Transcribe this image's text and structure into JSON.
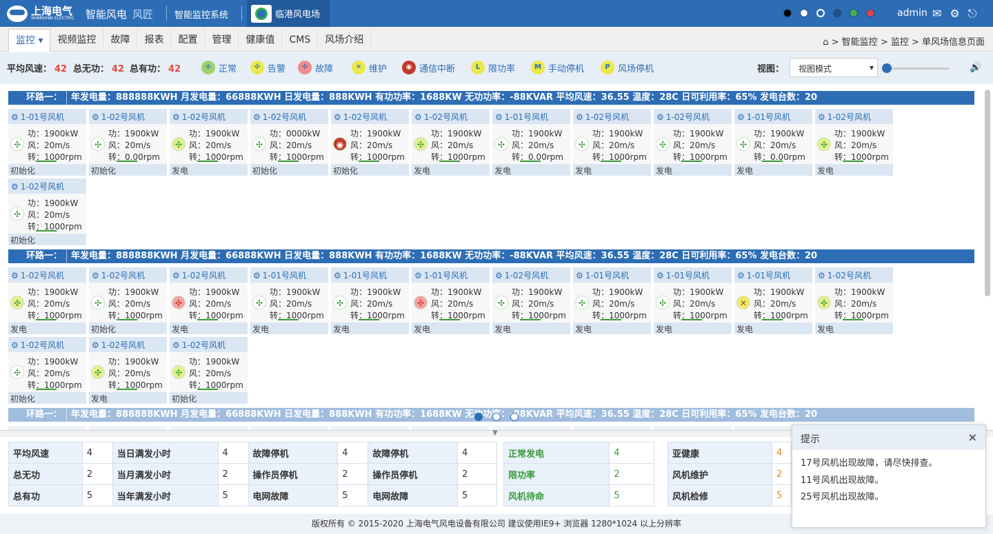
{
  "header": {
    "company": "上海电气",
    "company_en": "SHANGHAI ELECTRIC",
    "brand": "智能风电",
    "brand_sub": "风匠",
    "system": "智能监控系统",
    "farm": "临港风电场",
    "theme_colors": [
      "#000000",
      "#ffffff",
      "#2d6db5",
      "#1e4f86",
      "#4cb050",
      "#e0474c"
    ],
    "user": "admin"
  },
  "nav": {
    "items": [
      "监控",
      "视频监控",
      "故障",
      "报表",
      "配置",
      "管理",
      "健康值",
      "CMS",
      "风场介绍"
    ],
    "breadcrumb": "> 智能监控 > 监控 > 单风场信息页面"
  },
  "legend": {
    "stats": [
      {
        "label": "平均风速：",
        "value": "42"
      },
      {
        "label": "总无功：",
        "value": "42"
      },
      {
        "label": "总有功：",
        "value": "42"
      }
    ],
    "states": [
      {
        "label": "正常",
        "icon": "turbine-normal-icon",
        "color": "#9ed36a"
      },
      {
        "label": "告警",
        "icon": "turbine-alarm-icon",
        "color": "#e9e94a"
      },
      {
        "label": "故障",
        "icon": "turbine-fault-icon",
        "color": "#f28c8c"
      },
      {
        "label": "维护",
        "icon": "wrench-icon",
        "color": "#e9e94a"
      },
      {
        "label": "通信中断",
        "icon": "comm-lost-icon",
        "color": "#c0392b"
      },
      {
        "label": "限功率",
        "letter": "L",
        "color": "#e9e94a"
      },
      {
        "label": "手动停机",
        "letter": "M",
        "color": "#e9e94a"
      },
      {
        "label": "风场停机",
        "letter": "P",
        "color": "#e9e94a"
      }
    ],
    "view_label": "视图：",
    "view_value": "视图模式"
  },
  "loop_bar": {
    "label": "环路一：",
    "values": "年发电量：888888KWH 月发电量：66888KWH 日发电量：888KWH 有功功率：1688KW 无功功率：-88KVAR 平均风速：36.55 温度：28C 日可利用率：65% 发电台数：20"
  },
  "loops": [
    {
      "turbines": [
        {
          "name": "1-01号风机",
          "power": "功：1900kW",
          "wind": "风：20m/s",
          "speed": "转：1000rpm",
          "status": "初始化",
          "state": "normal"
        },
        {
          "name": "1-02号风机",
          "power": "功：1900kW",
          "wind": "风：20m/s",
          "speed": "转：0.00rpm",
          "status": "初始化",
          "state": "normal"
        },
        {
          "name": "1-02号风机",
          "power": "功：1900kW",
          "wind": "风：20m/s",
          "speed": "转：1000rpm",
          "status": "发电",
          "state": "active"
        },
        {
          "name": "1-02号风机",
          "power": "功：0000kW",
          "wind": "风：20m/s",
          "speed": "转：1000rpm",
          "status": "初始化",
          "state": "normal"
        },
        {
          "name": "1-02号风机",
          "power": "功：1900kW",
          "wind": "风：20m/s",
          "speed": "转：1000rpm",
          "status": "初始化",
          "state": "comm"
        },
        {
          "name": "1-02号风机",
          "power": "功：1900kW",
          "wind": "风：20m/s",
          "speed": "转：1000rpm",
          "status": "发电",
          "state": "active"
        },
        {
          "name": "1-01号风机",
          "power": "功：1900kW",
          "wind": "风：20m/s",
          "speed": "转：0.00rpm",
          "status": "发电",
          "state": "normal"
        },
        {
          "name": "1-02号风机",
          "power": "功：1900kW",
          "wind": "风：20m/s",
          "speed": "转：1000rpm",
          "status": "发电",
          "state": "normal"
        },
        {
          "name": "1-02号风机",
          "power": "功：1900kW",
          "wind": "风：20m/s",
          "speed": "转：1000rpm",
          "status": "发电",
          "state": "normal"
        },
        {
          "name": "1-01号风机",
          "power": "功：1900kW",
          "wind": "风：20m/s",
          "speed": "转：0.00rpm",
          "status": "发电",
          "state": "normal"
        },
        {
          "name": "1-02号风机",
          "power": "功：1900kW",
          "wind": "风：20m/s",
          "speed": "转：1000rpm",
          "status": "发电",
          "state": "active"
        },
        {
          "name": "1-02号风机",
          "power": "功：1900kW",
          "wind": "风：20m/s",
          "speed": "转：1000rpm",
          "status": "初始化",
          "state": "normal"
        }
      ]
    },
    {
      "turbines": [
        {
          "name": "1-02号风机",
          "power": "功：1900kW",
          "wind": "风：20m/s",
          "speed": "转：1000rpm",
          "status": "发电",
          "state": "active"
        },
        {
          "name": "1-02号风机",
          "power": "功：1900kW",
          "wind": "风：20m/s",
          "speed": "转：1000rpm",
          "status": "初始化",
          "state": "normal"
        },
        {
          "name": "1-02号风机",
          "power": "功：1900kW",
          "wind": "风：20m/s",
          "speed": "转：1000rpm",
          "status": "发电",
          "state": "fault"
        },
        {
          "name": "1-01号风机",
          "power": "功：1900kW",
          "wind": "风：20m/s",
          "speed": "转：1000rpm",
          "status": "发电",
          "state": "normal"
        },
        {
          "name": "1-01号风机",
          "power": "功：1900kW",
          "wind": "风：20m/s",
          "speed": "转：1000rpm",
          "status": "发电",
          "state": "normal"
        },
        {
          "name": "1-01号风机",
          "power": "功：1900kW",
          "wind": "风：20m/s",
          "speed": "转：1000rpm",
          "status": "发电",
          "state": "fault"
        },
        {
          "name": "1-02号风机",
          "power": "功：1900kW",
          "wind": "风：20m/s",
          "speed": "转：1000rpm",
          "status": "发电",
          "state": "normal"
        },
        {
          "name": "1-01号风机",
          "power": "功：1900kW",
          "wind": "风：20m/s",
          "speed": "转：1000rpm",
          "status": "发电",
          "state": "normal"
        },
        {
          "name": "1-01号风机",
          "power": "功：1900kW",
          "wind": "风：20m/s",
          "speed": "转：1000rpm",
          "status": "发电",
          "state": "normal"
        },
        {
          "name": "1-01号风机",
          "power": "功：1900kW",
          "wind": "风：20m/s",
          "speed": "转：1000rpm",
          "status": "发电",
          "state": "maint"
        },
        {
          "name": "1-02号风机",
          "power": "功：1900kW",
          "wind": "风：20m/s",
          "speed": "转：1000rpm",
          "status": "发电",
          "state": "active"
        },
        {
          "name": "1-02号风机",
          "power": "功：1900kW",
          "wind": "风：20m/s",
          "speed": "转：1000rpm",
          "status": "初始化",
          "state": "normal"
        },
        {
          "name": "1-02号风机",
          "power": "功：1900kW",
          "wind": "风：20m/s",
          "speed": "转：1000rpm",
          "status": "发电",
          "state": "active"
        },
        {
          "name": "1-02号风机",
          "power": "功：1900kW",
          "wind": "风：20m/s",
          "speed": "转：1000rpm",
          "status": "初始化",
          "state": "active"
        }
      ]
    }
  ],
  "stats_tables": [
    [
      [
        "平均风速",
        "4",
        "当日满发小时",
        "4",
        "故障停机",
        "4",
        "故障停机",
        "4"
      ],
      [
        "总无功",
        "2",
        "当月满发小时",
        "2",
        "操作员停机",
        "2",
        "操作员停机",
        "2"
      ],
      [
        "总有功",
        "5",
        "当年满发小时",
        "5",
        "电网故障",
        "5",
        "电网故障",
        "5"
      ]
    ],
    [
      [
        "正常发电",
        "4"
      ],
      [
        "限功率",
        "2"
      ],
      [
        "风机待命",
        "5"
      ]
    ],
    [
      [
        "亚健康",
        "4"
      ],
      [
        "风机维护",
        "2"
      ],
      [
        "风机检修",
        "5"
      ]
    ]
  ],
  "state_colors": {
    "green": "#3a9a3a",
    "orange": "#e08a1e"
  },
  "popup": {
    "title": "提示",
    "messages": [
      "17号风机出现故障，请尽快排查。",
      "11号风机出现故障。",
      "25号风机出现故障。"
    ]
  },
  "footer": "版权所有 © 2015-2020 上海电气风电设备有限公司 建议使用IE9+ 浏览器 1280*1024 以上分辨率"
}
